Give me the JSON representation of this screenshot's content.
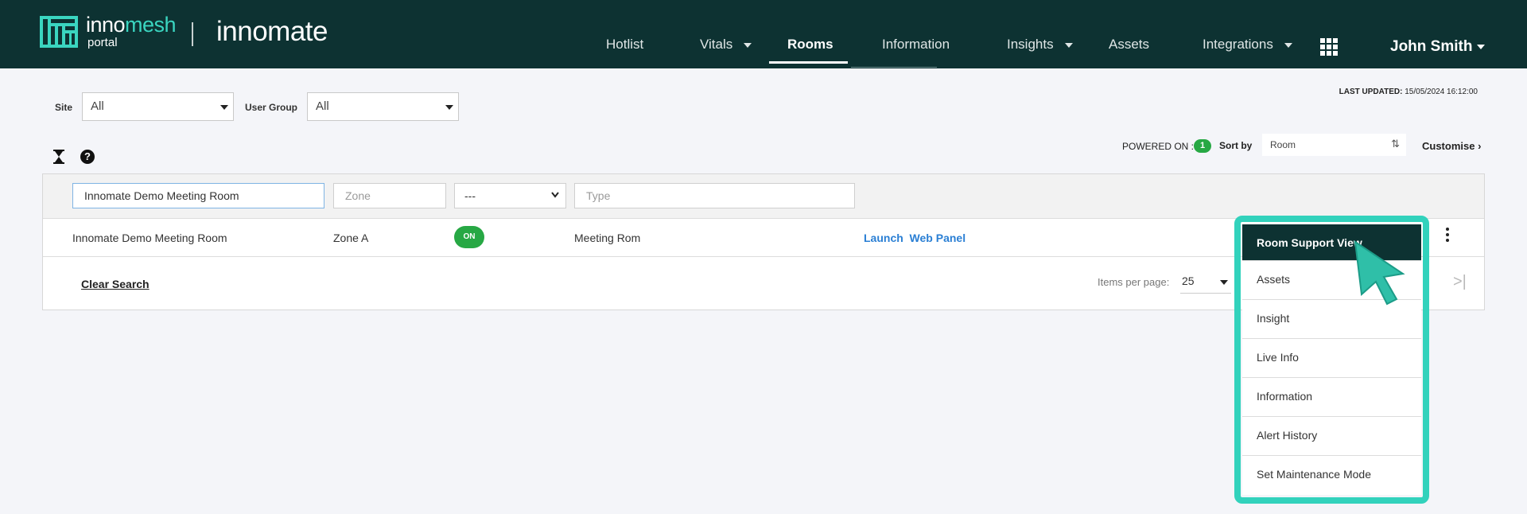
{
  "header": {
    "brand_prefix": "inno",
    "brand_suffix": "mesh",
    "brand_sub": "portal",
    "product": "innomate",
    "nav": [
      {
        "label": "Hotlist",
        "dropdown": false
      },
      {
        "label": "Vitals",
        "dropdown": true
      },
      {
        "label": "Rooms",
        "dropdown": false,
        "active": true
      },
      {
        "label": "Information",
        "dropdown": false
      },
      {
        "label": "Insights",
        "dropdown": true
      },
      {
        "label": "Assets",
        "dropdown": false
      },
      {
        "label": "Integrations",
        "dropdown": true
      }
    ],
    "user": "John Smith"
  },
  "filters": {
    "site_label": "Site",
    "site_value": "All",
    "user_group_label": "User Group",
    "user_group_value": "All"
  },
  "last_updated": {
    "label": "LAST UPDATED:",
    "value": "15/05/2024 16:12:00"
  },
  "toolbar": {
    "powered_on_label": "POWERED ON :",
    "powered_on_count": "1",
    "sort_label": "Sort by",
    "sort_value": "Room",
    "customise": "Customise"
  },
  "table": {
    "filter_row": {
      "name_value": "Innomate Demo Meeting Room",
      "zone_placeholder": "Zone",
      "status_value": "---",
      "type_placeholder": "Type"
    },
    "rows": [
      {
        "name": "Innomate Demo Meeting Room",
        "zone": "Zone A",
        "status": "ON",
        "type": "Meeting Rom",
        "action": "Launch  Web Panel"
      }
    ],
    "clear_search": "Clear Search",
    "items_per_page_label": "Items per page:",
    "items_per_page_value": "25"
  },
  "row_menu": {
    "items": [
      "Room Support View",
      "Assets",
      "Insight",
      "Live Info",
      "Information",
      "Alert History",
      "Set Maintenance Mode"
    ],
    "active_index": 0
  },
  "colors": {
    "header_bg": "#0d3232",
    "accent_teal": "#32d2bc",
    "status_green": "#27a844",
    "link_blue": "#2a7fd4"
  }
}
